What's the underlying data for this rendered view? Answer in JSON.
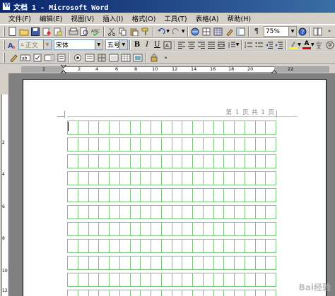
{
  "window": {
    "title": "文档 1 - Microsoft Word"
  },
  "menu": [
    "文件(F)",
    "编辑(E)",
    "视图(V)",
    "插入(I)",
    "格式(O)",
    "工具(T)",
    "表格(A)",
    "帮助(H)"
  ],
  "toolbar": {
    "zoom": "75%",
    "style": "正文",
    "font": "宋体",
    "size": "五号",
    "bold": "B",
    "italic": "I",
    "underline": "U",
    "font_color_label": "A"
  },
  "ruler": {
    "numbers": [
      "2",
      "2",
      "4",
      "6",
      "8",
      "10",
      "12",
      "14",
      "16",
      "18",
      "20",
      "22"
    ]
  },
  "vruler": {
    "numbers": [
      "2",
      "4",
      "6",
      "8",
      "10",
      "12"
    ]
  },
  "document": {
    "header": "第 1 页 共 1 页"
  },
  "watermark": "Bai经验",
  "colors": {
    "grid": "#7bc47b",
    "titlebar": "#0a246a"
  }
}
